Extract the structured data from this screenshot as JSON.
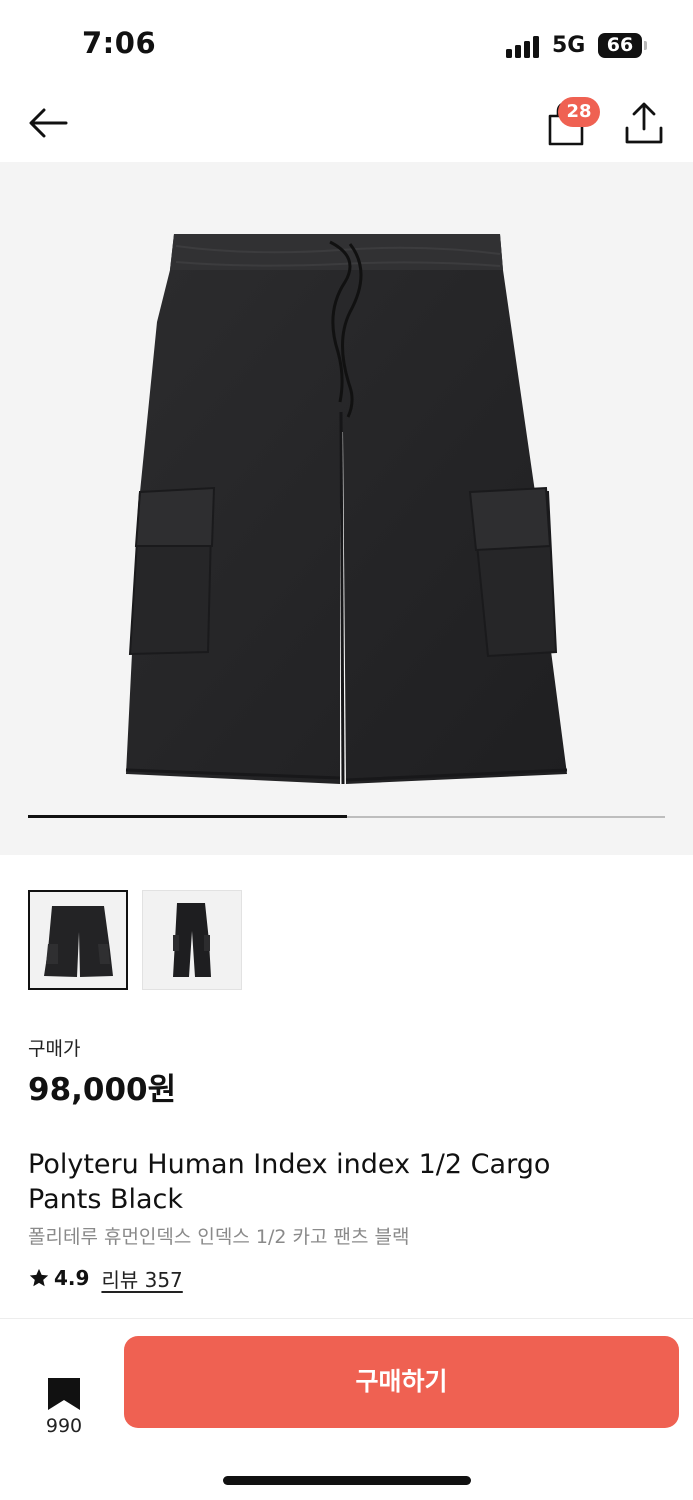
{
  "status_bar": {
    "time": "7:06",
    "network": "5G",
    "battery": "66"
  },
  "nav": {
    "back_icon": "arrow-left-icon",
    "cart_icon": "shopping-bag-icon",
    "cart_count": "28",
    "share_icon": "share-icon"
  },
  "gallery": {
    "image_count": 2,
    "current_index": 1,
    "progress_fraction": 0.5
  },
  "price": {
    "label": "구매가",
    "value": "98,000원"
  },
  "product": {
    "name_en": "Polyteru Human Index index 1/2 Cargo Pants Black",
    "name_ko": "폴리테루 휴먼인덱스 인덱스 1/2 카고 팬츠 블랙",
    "rating": "4.9",
    "reviews": "리뷰 357"
  },
  "bottom_bar": {
    "bookmark_icon": "bookmark-icon",
    "bookmark_count": "990",
    "buy_label": "구매하기"
  },
  "colors": {
    "accent": "#ef6152",
    "image_background": "#f4f4f4",
    "text_primary": "#111111",
    "text_secondary": "#8a8a8a"
  }
}
